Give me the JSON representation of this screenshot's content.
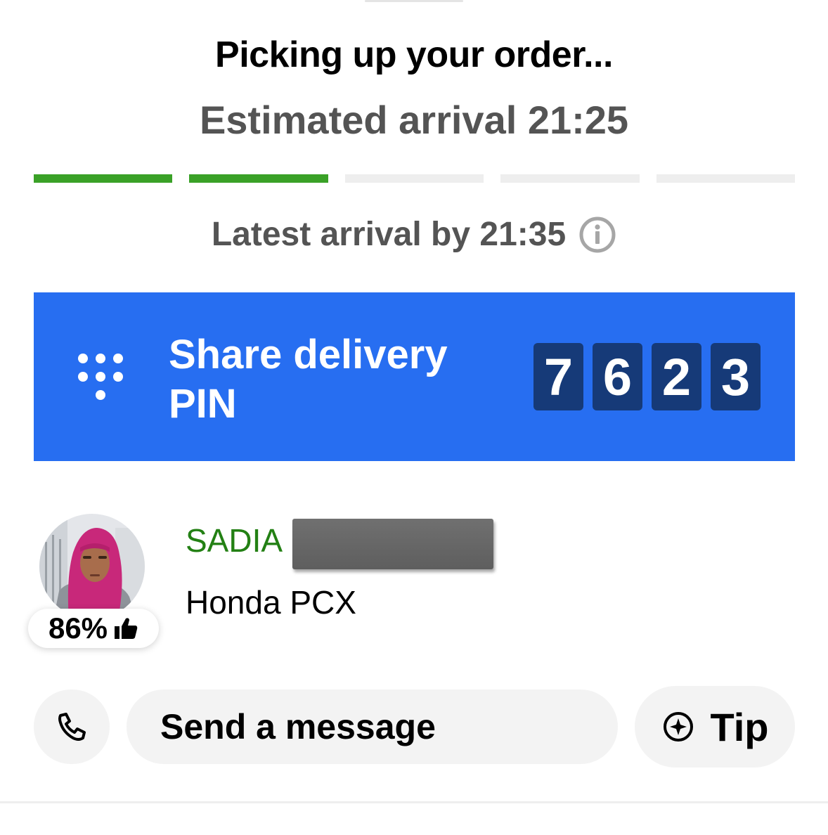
{
  "status": {
    "title": "Picking up your order...",
    "estimated_arrival": "Estimated arrival 21:25",
    "latest_arrival": "Latest arrival by 21:35"
  },
  "progress": {
    "total_steps": 5,
    "completed_steps": 2,
    "complete_color": "#3aa127",
    "pending_color": "#eeeeee"
  },
  "pin_card": {
    "label": "Share delivery PIN",
    "digits": [
      "7",
      "6",
      "2",
      "3"
    ],
    "background_color": "#276ef1",
    "digit_box_color": "#163a78"
  },
  "courier": {
    "first_name": "SADIA",
    "last_name_redacted": true,
    "vehicle": "Honda PCX",
    "rating": "86%",
    "name_color": "#238014"
  },
  "actions": {
    "message_label": "Send a message",
    "tip_label": "Tip"
  },
  "icons": {
    "info": "info-icon",
    "pin": "dialpad-icon",
    "rating": "thumbs-up-icon",
    "call": "phone-icon",
    "tip": "compass-star-icon"
  }
}
